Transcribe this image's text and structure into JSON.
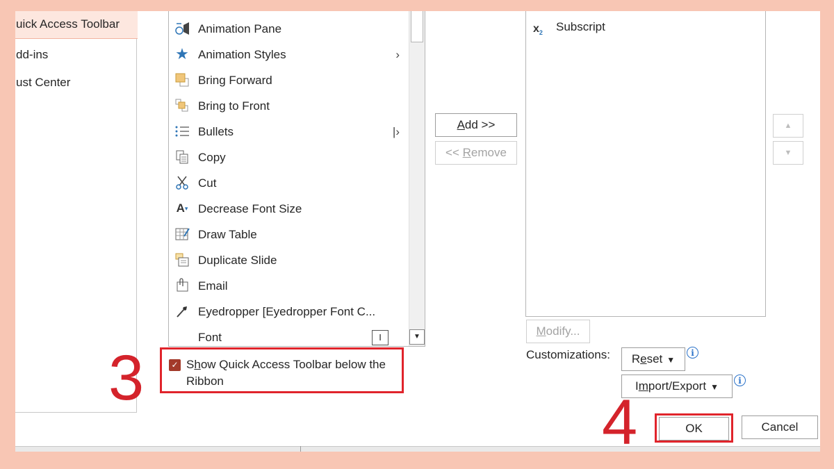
{
  "nav": {
    "items": [
      {
        "label": "uick Access Toolbar",
        "selected": true
      },
      {
        "label": "dd-ins",
        "selected": false
      },
      {
        "label": "ust Center",
        "selected": false
      }
    ]
  },
  "commands": {
    "items": [
      {
        "label": "Animation Pane",
        "icon": "animation-pane-icon",
        "glyph": "⏱"
      },
      {
        "label": "Animation Styles",
        "icon": "star-icon",
        "glyph": "★",
        "submenu": "›"
      },
      {
        "label": "Bring Forward",
        "icon": "bring-forward-icon",
        "glyph": "▣"
      },
      {
        "label": "Bring to Front",
        "icon": "bring-to-front-icon",
        "glyph": "◫"
      },
      {
        "label": "Bullets",
        "icon": "bullets-icon",
        "glyph": "☰",
        "submenu": "|›"
      },
      {
        "label": "Copy",
        "icon": "copy-icon",
        "glyph": "⎘"
      },
      {
        "label": "Cut",
        "icon": "scissors-icon",
        "glyph": "✂"
      },
      {
        "label": "Decrease Font Size",
        "icon": "decrease-font-icon",
        "glyph": "A"
      },
      {
        "label": "Draw Table",
        "icon": "draw-table-icon",
        "glyph": "▦"
      },
      {
        "label": "Duplicate Slide",
        "icon": "duplicate-slide-icon",
        "glyph": "⧉"
      },
      {
        "label": "Email",
        "icon": "email-icon",
        "glyph": "✉"
      },
      {
        "label": "Eyedropper [Eyedropper Font C...",
        "icon": "eyedropper-icon",
        "glyph": "✎"
      },
      {
        "label": "Font",
        "icon": "",
        "glyph": ""
      }
    ],
    "font_control": "I"
  },
  "checkbox": {
    "label_prefix": "S",
    "label_mnemonic": "h",
    "label_rest": "ow Quick Access Toolbar below the Ribbon",
    "checked": true
  },
  "steps": {
    "three": "3",
    "four": "4"
  },
  "buttons": {
    "add_mnemonic": "A",
    "add_rest": "dd >>",
    "remove_prefix": "<< ",
    "remove_mnemonic": "R",
    "remove_rest": "emove",
    "modify_mnemonic": "M",
    "modify_rest": "odify...",
    "reset_prefix": "R",
    "reset_mnemonic": "e",
    "reset_rest": "set",
    "import_prefix": "I",
    "import_mnemonic": "m",
    "import_rest": "port/Export",
    "ok": "OK",
    "cancel": "Cancel"
  },
  "qat": {
    "items": [
      {
        "label": "Subscript",
        "icon": "subscript-icon"
      }
    ],
    "customizations_label": "Customizations:"
  },
  "colors": {
    "accent_red": "#e0242b",
    "step_red": "#d4232b",
    "checkbox": "#a33a2a",
    "info_blue": "#2b72c9",
    "background": "#f8c6b4"
  }
}
